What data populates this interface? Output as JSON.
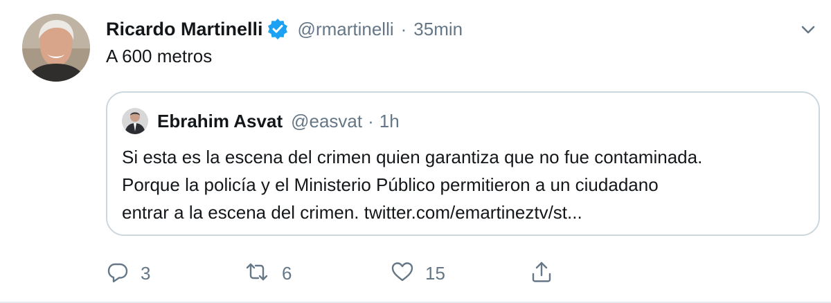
{
  "tweet": {
    "author_name": "Ricardo Martinelli",
    "handle": "@rmartinelli",
    "separator": "·",
    "timestamp": "35min",
    "text": "A 600 metros",
    "verified_icon": "verified-badge-icon",
    "caret_icon": "chevron-down-icon"
  },
  "quoted": {
    "author_name": "Ebrahim Asvat",
    "handle": "@easvat",
    "separator": "·",
    "timestamp": "1h",
    "text_lines": [
      "Si esta es la escena del crimen quien garantiza que no fue contaminada.",
      "Porque la policía y el Ministerio Público permitieron a un ciudadano",
      "entrar a la escena del crimen. twitter.com/emartineztv/st..."
    ]
  },
  "actions": {
    "reply": {
      "icon": "reply-icon",
      "count": "3"
    },
    "retweet": {
      "icon": "retweet-icon",
      "count": "6"
    },
    "like": {
      "icon": "heart-icon",
      "count": "15"
    },
    "share": {
      "icon": "share-icon",
      "count": ""
    }
  },
  "colors": {
    "text_primary": "#14171a",
    "text_secondary": "#657786",
    "verified_blue": "#1da1f2",
    "border": "#ccd6dd"
  }
}
